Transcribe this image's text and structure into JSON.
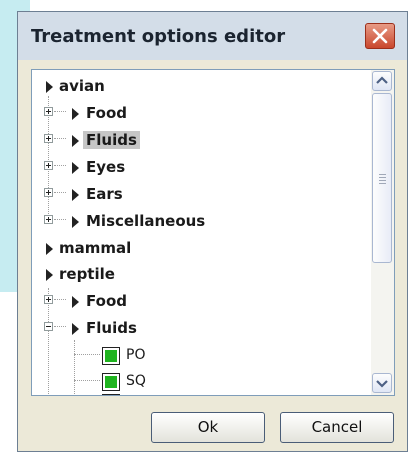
{
  "window": {
    "title": "Treatment options editor"
  },
  "tree": {
    "rows": [
      {
        "label": "avian"
      },
      {
        "label": "Food"
      },
      {
        "label": "Fluids",
        "selected": true
      },
      {
        "label": "Eyes"
      },
      {
        "label": "Ears"
      },
      {
        "label": "Miscellaneous"
      },
      {
        "label": "mammal"
      },
      {
        "label": "reptile"
      },
      {
        "label": "Food"
      },
      {
        "label": "Fluids"
      },
      {
        "label": "PO",
        "checked": true
      },
      {
        "label": "SQ",
        "checked": true
      }
    ]
  },
  "buttons": {
    "ok": "Ok",
    "cancel": "Cancel"
  },
  "icons": {
    "close": "close-icon",
    "expand": "plus-box-icon",
    "collapse": "minus-box-icon",
    "caret": "triangle-right-icon",
    "scroll_up": "scroll-up-arrow-icon",
    "scroll_down": "scroll-down-arrow-icon"
  },
  "colors": {
    "checkbox_fill": "#1fb41f",
    "selection": "#c6c6c6",
    "close_button": "#c9472d"
  }
}
